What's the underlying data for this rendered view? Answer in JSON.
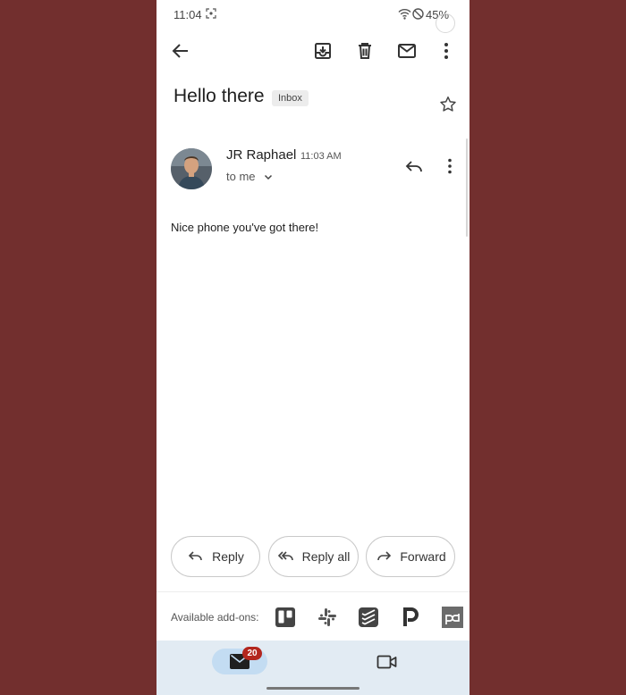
{
  "status_bar": {
    "time": "11:04",
    "battery": "45%"
  },
  "toolbar": {
    "back_icon": "arrow-left-icon",
    "archive_icon": "archive-icon",
    "delete_icon": "trash-icon",
    "unread_icon": "mail-icon",
    "more_icon": "more-vert-icon"
  },
  "email": {
    "subject": "Hello there",
    "label": "Inbox",
    "sender": "JR Raphael",
    "time": "11:03 AM",
    "recipient": "to me",
    "body": "Nice phone you've got there!"
  },
  "actions": {
    "reply": "Reply",
    "reply_all": "Reply all",
    "forward": "Forward"
  },
  "addons": {
    "label": "Available add-ons:",
    "items": [
      "trello-icon",
      "slack-icon",
      "todoist-icon",
      "pipedrive-icon",
      "pandadoc-icon"
    ]
  },
  "bottom_nav": {
    "mail_badge": "20"
  },
  "colors": {
    "background": "#722f2e",
    "nav_background": "#e2ebf3",
    "nav_active": "#c3dcf2",
    "badge": "#b3261e"
  }
}
